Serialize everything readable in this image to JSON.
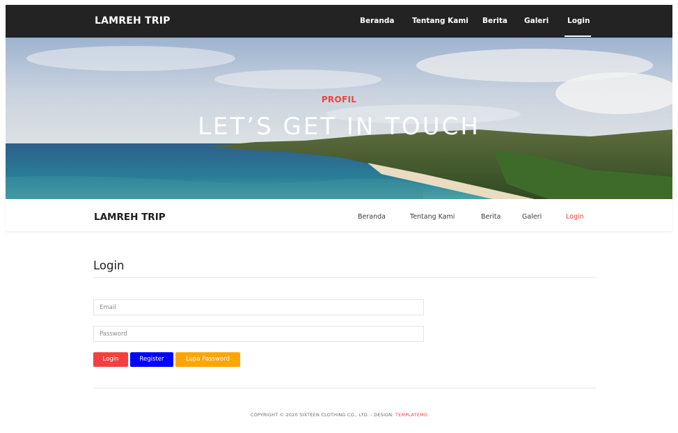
{
  "top_navbar": {
    "brand": "LAMREH TRIP",
    "items": [
      {
        "label": "Beranda"
      },
      {
        "label": "Tentang Kami"
      },
      {
        "label": "Berita"
      },
      {
        "label": "Galeri"
      },
      {
        "label": "Login",
        "active": true
      }
    ]
  },
  "hero": {
    "kicker": "PROFIL",
    "headline": "LET’S GET IN TOUCH"
  },
  "main_navbar": {
    "brand": "LAMREH TRIP",
    "items": [
      {
        "label": "Beranda"
      },
      {
        "label": "Tentang Kami"
      },
      {
        "label": "Berita"
      },
      {
        "label": "Galeri"
      },
      {
        "label": "Login",
        "active": true
      }
    ]
  },
  "login": {
    "title": "Login",
    "email_placeholder": "Email",
    "password_placeholder": "Password",
    "buttons": {
      "login": "Login",
      "register": "Register",
      "forgot": "Lupa Password"
    }
  },
  "footer": {
    "text": "COPYRIGHT © 2020 SIXTEEN CLOTHING CO., LTD. - DESIGN:",
    "link": "TEMPLATEMO"
  },
  "colors": {
    "accent": "#f33f3f",
    "navbar_dark": "#232323",
    "register_button": "#0000ff",
    "forgot_button": "#ffa500"
  }
}
